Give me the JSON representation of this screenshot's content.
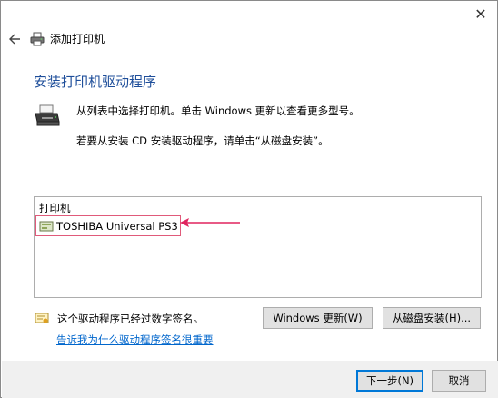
{
  "window": {
    "title": "添加打印机",
    "close_glyph": "✕"
  },
  "heading": "安装打印机驱动程序",
  "description": {
    "line1": "从列表中选择打印机。单击 Windows 更新以查看更多型号。",
    "line2": "若要从安装 CD 安装驱动程序，请单击“从磁盘安装”。"
  },
  "printer_list": {
    "header": "打印机",
    "items": [
      {
        "label": "TOSHIBA Universal PS3",
        "selected": true
      }
    ]
  },
  "annotation": {
    "color": "#e0245e"
  },
  "signature": {
    "status": "这个驱动程序已经过数字签名。",
    "link": "告诉我为什么驱动程序签名很重要"
  },
  "buttons": {
    "windows_update": "Windows 更新(W)",
    "have_disk": "从磁盘安装(H)...",
    "next": "下一步(N)",
    "cancel": "取消"
  },
  "colors": {
    "heading": "#1e4e9a",
    "link": "#0066cc",
    "focus": "#0078d7"
  }
}
